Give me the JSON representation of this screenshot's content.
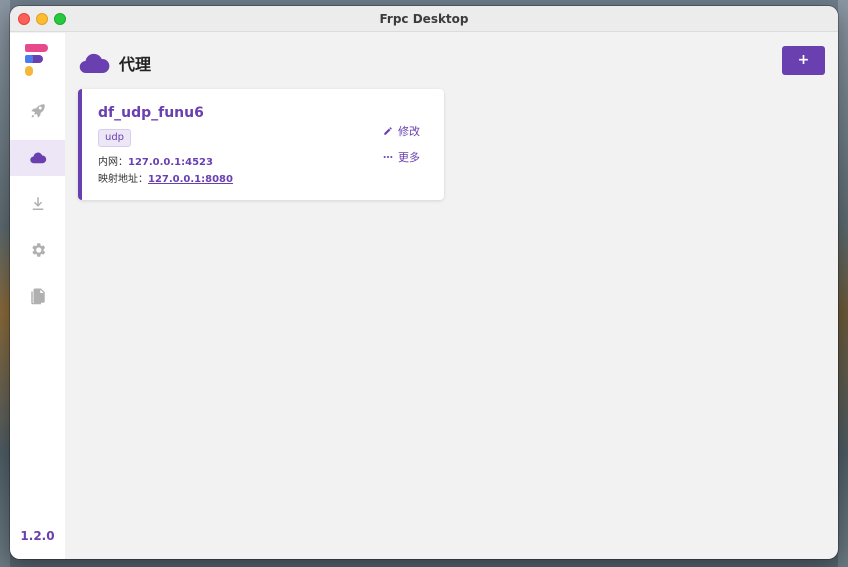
{
  "window": {
    "title": "Frpc Desktop"
  },
  "sidebar": {
    "items": [
      {
        "icon": "rocket-icon",
        "active": false
      },
      {
        "icon": "cloud-icon",
        "active": true
      },
      {
        "icon": "download-icon",
        "active": false
      },
      {
        "icon": "gear-icon",
        "active": false
      },
      {
        "icon": "document-icon",
        "active": false
      }
    ],
    "version": "1.2.0"
  },
  "header": {
    "title": "代理",
    "add_label": "+"
  },
  "proxies": [
    {
      "name": "df_udp_funu6",
      "type": "udp",
      "local_label": "内网：",
      "local_value": "127.0.0.1:4523",
      "mapped_label": "映射地址：",
      "mapped_value": "127.0.0.1:8080",
      "edit_label": "修改",
      "more_label": "更多"
    }
  ],
  "colors": {
    "accent": "#6a3fb0",
    "accent_light": "#ece6f6",
    "background": "#f2f2f2"
  }
}
